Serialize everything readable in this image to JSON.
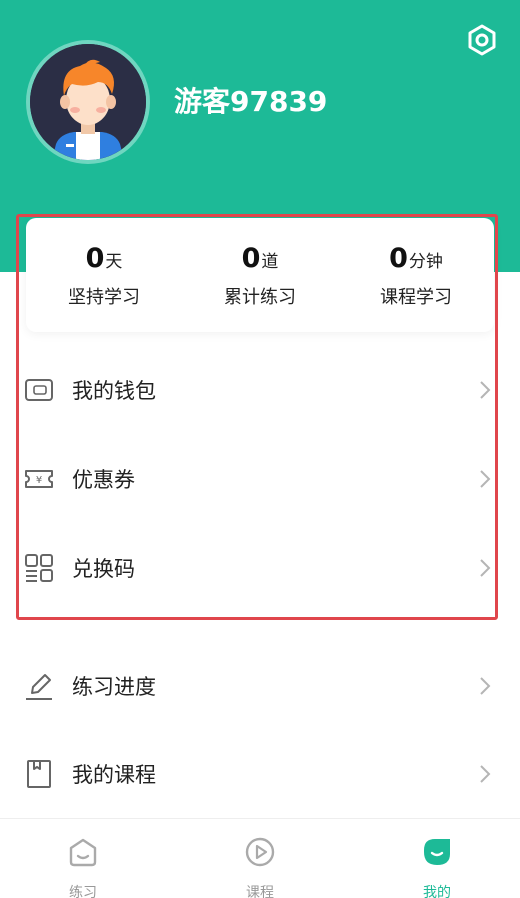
{
  "colors": {
    "brand": "#1dba97",
    "highlight": "#e0464c"
  },
  "header": {
    "username": "游客97839",
    "settings_icon": "gear-icon"
  },
  "stats": [
    {
      "value": "0",
      "unit": "天",
      "label": "坚持学习"
    },
    {
      "value": "0",
      "unit": "道",
      "label": "累计练习"
    },
    {
      "value": "0",
      "unit": "分钟",
      "label": "课程学习"
    }
  ],
  "menu": [
    {
      "label": "我的钱包",
      "icon": "wallet-icon"
    },
    {
      "label": "优惠券",
      "icon": "coupon-icon"
    },
    {
      "label": "兑换码",
      "icon": "redeem-code-icon"
    },
    {
      "label": "练习进度",
      "icon": "pencil-icon"
    },
    {
      "label": "我的课程",
      "icon": "book-icon"
    }
  ],
  "tabs": [
    {
      "label": "练习",
      "icon": "practice-icon",
      "active": false
    },
    {
      "label": "课程",
      "icon": "play-icon",
      "active": false
    },
    {
      "label": "我的",
      "icon": "profile-icon",
      "active": true
    }
  ]
}
